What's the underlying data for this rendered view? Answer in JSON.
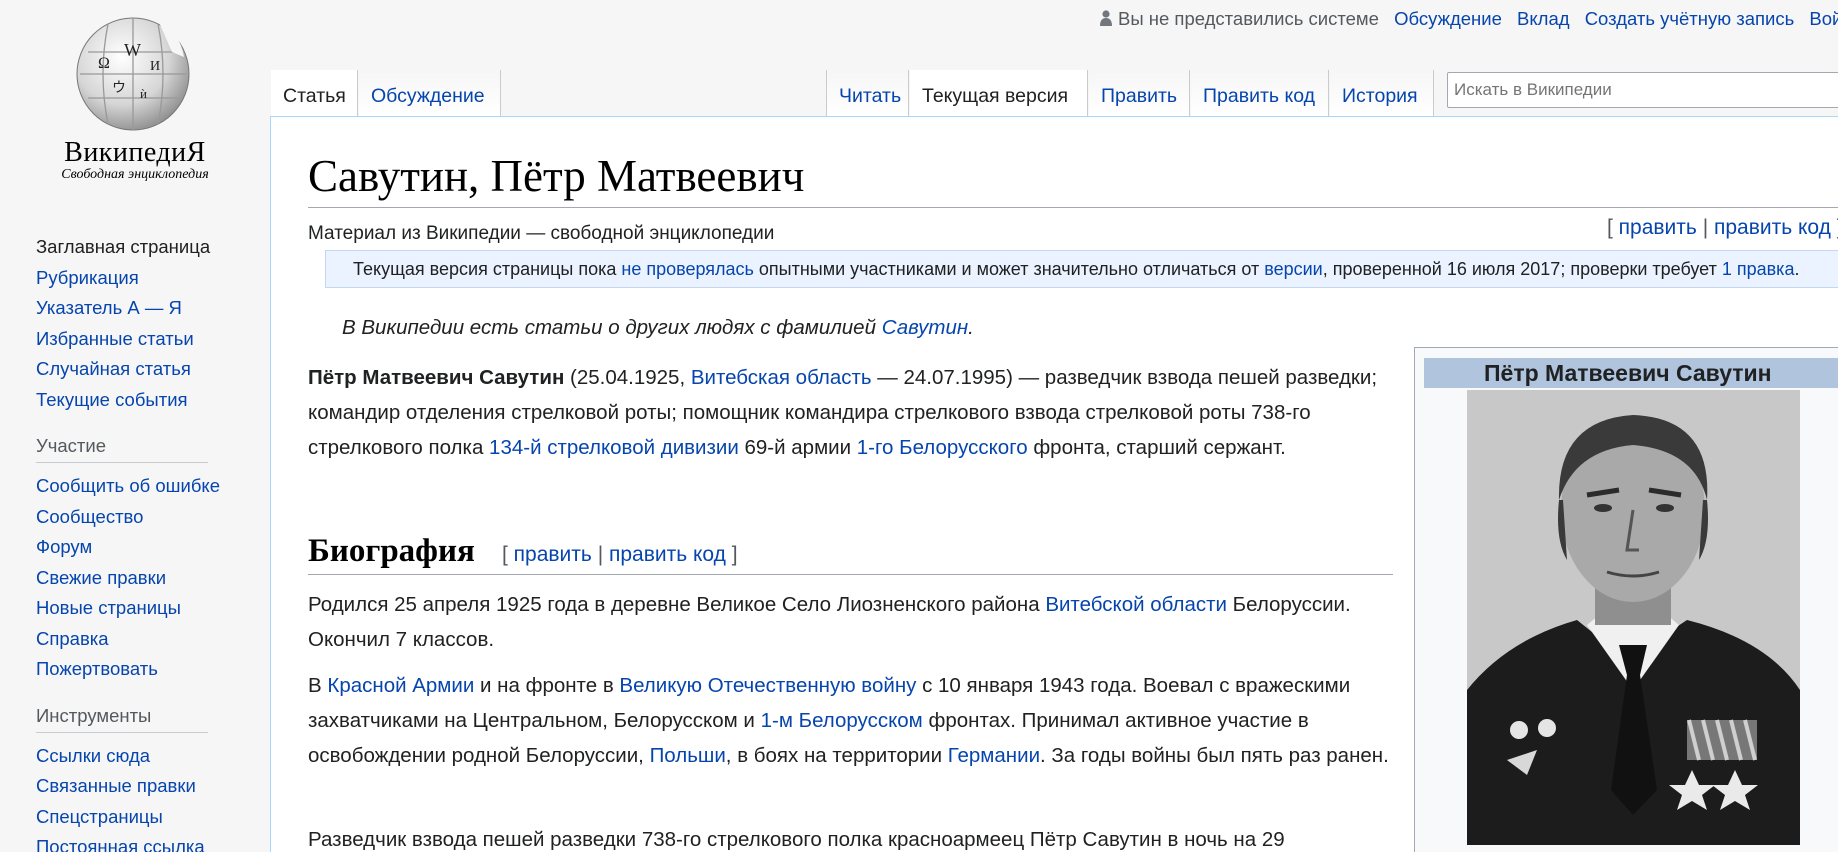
{
  "logo": {
    "name": "ВикипедиЯ",
    "tagline": "Свободная энциклопедия"
  },
  "sidebar": {
    "nav": [
      "Заглавная страница",
      "Рубрикация",
      "Указатель А — Я",
      "Избранные статьи",
      "Случайная статья",
      "Текущие события"
    ],
    "participation_heading": "Участие",
    "participation": [
      "Сообщить об ошибке",
      "Сообщество",
      "Форум",
      "Свежие правки",
      "Новые страницы",
      "Справка",
      "Пожертвовать"
    ],
    "tools_heading": "Инструменты",
    "tools": [
      "Ссылки сюда",
      "Связанные правки",
      "Спецстраницы",
      "Постоянная ссылка"
    ]
  },
  "personal": {
    "anon": "Вы не представились системе",
    "talk": "Обсуждение",
    "contrib": "Вклад",
    "create": "Создать учётную запись",
    "login": "Войти"
  },
  "tabs": {
    "article": "Статья",
    "talk": "Обсуждение",
    "read": "Читать",
    "current": "Текущая версия",
    "edit": "Править",
    "editcode": "Править код",
    "history": "История"
  },
  "search": {
    "placeholder": "Искать в Википедии"
  },
  "article": {
    "title": "Савутин, Пётр Матвеевич",
    "tagline": "Материал из Википедии — свободной энциклопедии",
    "top_edit": {
      "open": "[ ",
      "edit": "править",
      "sep": " | ",
      "editcode": "править код",
      "close": " ]"
    },
    "flagged": {
      "t1": "Текущая версия страницы пока ",
      "l1": "не проверялась",
      "t2": " опытными участниками и может значительно отличаться от ",
      "l2": "версии",
      "t3": ", проверенной 16 июля 2017; проверки требует ",
      "l3": "1 правка",
      "t4": "."
    },
    "hatnote": {
      "text": "В Википедии есть статьи о других людях с фамилией ",
      "link": "Савутин",
      "end": "."
    },
    "lead": {
      "bold": "Пётр Матвеевич Савутин",
      "t1": " (25.04.1925, ",
      "l1": "Витебская область",
      "t2": " — 24.07.1995) — разведчик взвода пешей разведки; командир отделения стрелковой роты; помощник командира стрелкового взвода стрелковой роты 738-го стрелкового полка ",
      "l2": "134-й стрелковой дивизии",
      "t3": " 69-й армии ",
      "l3": "1-го Белорусского",
      "t4": " фронта, старший сержант."
    },
    "section": {
      "heading": "Биография",
      "open": "[ ",
      "edit": "править",
      "sep": " | ",
      "editcode": "править код",
      "close": " ]"
    },
    "p1": {
      "t1": "Родился 25 апреля 1925 года в деревне Великое Село Лиозненского района ",
      "l1": "Витебской области",
      "t2": " Белоруссии. Окончил 7 классов."
    },
    "p2": {
      "t1": "В ",
      "l1": "Красной Армии",
      "t2": " и на фронте в ",
      "l2": "Великую Отечественную войну",
      "t3": " с 10 января 1943 года. Воевал с вражескими захватчиками на Центральном, Белорусском и ",
      "l3": "1-м Белорусском",
      "t4": " фронтах. Принимал активное участие в освобождении родной Белоруссии, ",
      "l4": "Польши",
      "t5": ", в боях на территории ",
      "l5": "Германии",
      "t6": ". За годы войны был пять раз ранен."
    },
    "p3": "Разведчик взвода пешей разведки 738-го стрелкового полка красноармеец Пётр Савутин в ночь на 29",
    "infobox": {
      "title": "Пётр Матвеевич Савутин"
    }
  },
  "colors": {
    "link": "#0645ad",
    "infobox_header": "#b0c4de",
    "flagged_bg": "#eaf3ff"
  }
}
